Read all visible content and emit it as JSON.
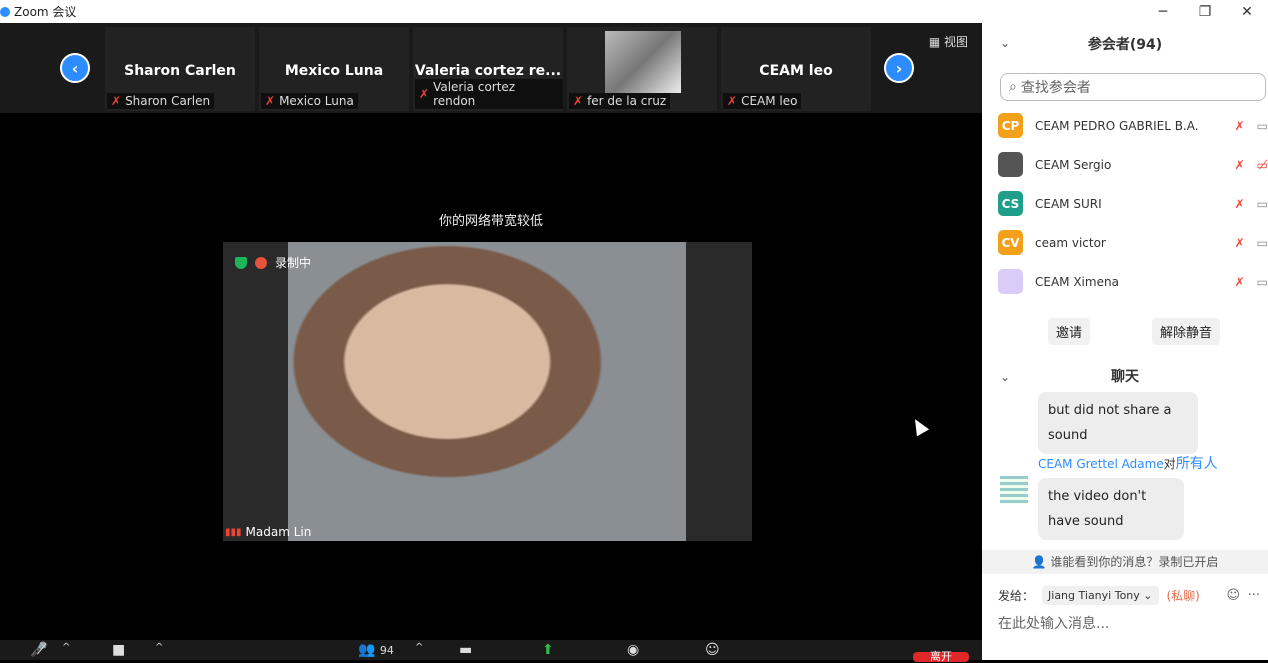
{
  "titlebar": {
    "title": "Zoom 会议"
  },
  "window": {
    "minimize": "─",
    "restore": "❐",
    "close": "✕"
  },
  "strip": {
    "tiles": [
      {
        "name": "Sharon Carlen",
        "label": "Sharon Carlen"
      },
      {
        "name": "Mexico Luna",
        "label": "Mexico Luna"
      },
      {
        "name": "Valeria  cortez  re...",
        "label": "Valeria cortez rendon"
      },
      {
        "name": "",
        "label": "fer de la cruz"
      },
      {
        "name": "CEAM leo",
        "label": "CEAM leo"
      }
    ],
    "view_label": "视图"
  },
  "main": {
    "warning": "你的网络带宽较低",
    "recording": "录制中",
    "speaker": "Madam Lin"
  },
  "toolbar": {
    "participants_count": "94",
    "end_label": "离开"
  },
  "panel": {
    "participants_title": "参会者(94)",
    "search_placeholder": "查找参会者",
    "participants": [
      {
        "initials": "CP",
        "name": "CEAM PEDRO GABRIEL B.A.",
        "color": "#f3a01b"
      },
      {
        "initials": "",
        "name": "CEAM Sergio",
        "color": "#555"
      },
      {
        "initials": "CS",
        "name": "CEAM SURI",
        "color": "#1f9e8a"
      },
      {
        "initials": "CV",
        "name": "ceam victor",
        "color": "#f3a01b"
      },
      {
        "initials": "",
        "name": "CEAM Ximena",
        "color": "#d9cdf7"
      }
    ],
    "invite": "邀请",
    "unmute_all": "解除静音",
    "chat_title": "聊天",
    "msg1": "but did not share a sound",
    "sender": "CEAM Grettel Adame",
    "sender_to": "对",
    "sender_all": "所有人",
    "msg2": "the video don't have sound",
    "notice": "谁能看到你的消息？录制已开启",
    "send_to_label": "发给：",
    "send_to": "Jiang Tianyi Tony",
    "private": "(私聊)",
    "input_placeholder": "在此处输入消息..."
  }
}
